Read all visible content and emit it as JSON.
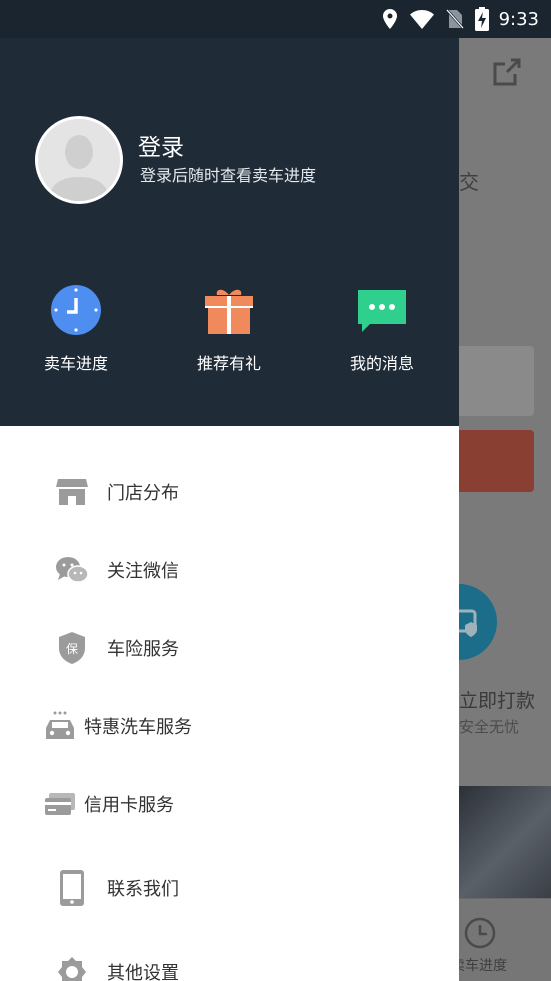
{
  "status_bar": {
    "time": "9:33",
    "icons": [
      "location-icon",
      "wifi-icon",
      "no-sim-icon",
      "battery-charging-icon"
    ]
  },
  "drawer": {
    "header": {
      "login_title": "登录",
      "login_subtitle": "登录后随时查看卖车进度",
      "quick_actions": [
        {
          "label": "卖车进度",
          "icon": "clock-icon",
          "color": "#4d8ef0"
        },
        {
          "label": "推荐有礼",
          "icon": "gift-icon",
          "color": "#f08a5d"
        },
        {
          "label": "我的消息",
          "icon": "message-icon",
          "color": "#2fcf8d"
        }
      ]
    },
    "menu": [
      {
        "label": "门店分布",
        "icon": "store-icon"
      },
      {
        "label": "关注微信",
        "icon": "wechat-icon"
      },
      {
        "label": "车险服务",
        "icon": "insurance-shield-icon",
        "badge": "保"
      },
      {
        "label": "特惠洗车服务",
        "icon": "car-wash-icon"
      },
      {
        "label": "信用卡服务",
        "icon": "credit-card-icon"
      },
      {
        "label": "联系我们",
        "icon": "phone-icon"
      },
      {
        "label": "其他设置",
        "icon": "settings-icon"
      }
    ]
  },
  "background_app": {
    "partial_text": "交",
    "pay_text": "立即打款",
    "safe_text": "安全无忧",
    "tab_label": "卖车进度"
  },
  "colors": {
    "header_bg": "#1f2b37",
    "status_bar_bg": "#1b2530",
    "menu_icon": "#9b9b9b",
    "menu_text": "#333333"
  }
}
